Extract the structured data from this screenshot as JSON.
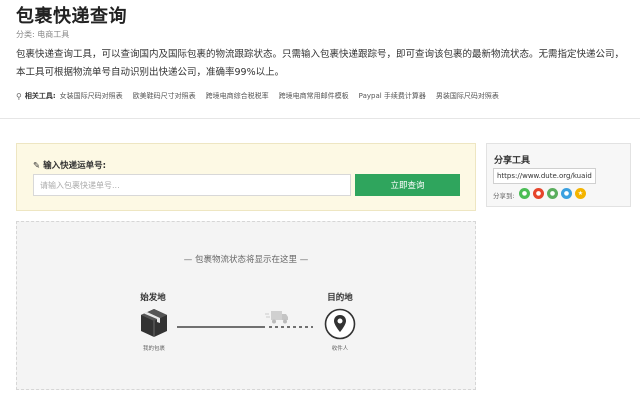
{
  "page": {
    "title": "包裹快递查询",
    "category_prefix": "分类:",
    "category_link": "电商工具",
    "description": "包裹快递查询工具，可以查询国内及国际包裹的物流跟踪状态。只需输入包裹快递跟踪号，即可查询该包裹的最新物流状态。无需指定快递公司，本工具可根据物流单号自动识别出快递公司，准确率99%以上。"
  },
  "related": {
    "label": "相关工具:",
    "links": [
      "女装国际尺码对照表",
      "欧美鞋码尺寸对照表",
      "跨境电商综合税税率",
      "跨境电商常用邮件模板",
      "Paypal 手续费计算器",
      "男装国际尺码对照表"
    ]
  },
  "query": {
    "label": "输入快递运单号:",
    "placeholder": "请输入包裹快递单号...",
    "value": "",
    "button": "立即查询"
  },
  "status": {
    "message": "— 包裹物流状态将显示在这里 —",
    "origin_title": "始发地",
    "origin_caption": "我的包裹",
    "dest_title": "目的地",
    "dest_caption": "收件人"
  },
  "share": {
    "title": "分享工具",
    "url": "https://www.dute.org/kuaidi",
    "share_to": "分享到:",
    "icons": [
      {
        "name": "wechat-icon",
        "color": "#4bbd55"
      },
      {
        "name": "weibo-icon",
        "color": "#e6442b"
      },
      {
        "name": "douban-icon",
        "color": "#5bae5e"
      },
      {
        "name": "qzone-icon",
        "color": "#3aa0e0"
      },
      {
        "name": "favorite-star-icon",
        "color": "#f4b400"
      }
    ]
  },
  "colors": {
    "accent_green": "#2fa55d",
    "query_panel_bg": "#fdf9e4"
  }
}
